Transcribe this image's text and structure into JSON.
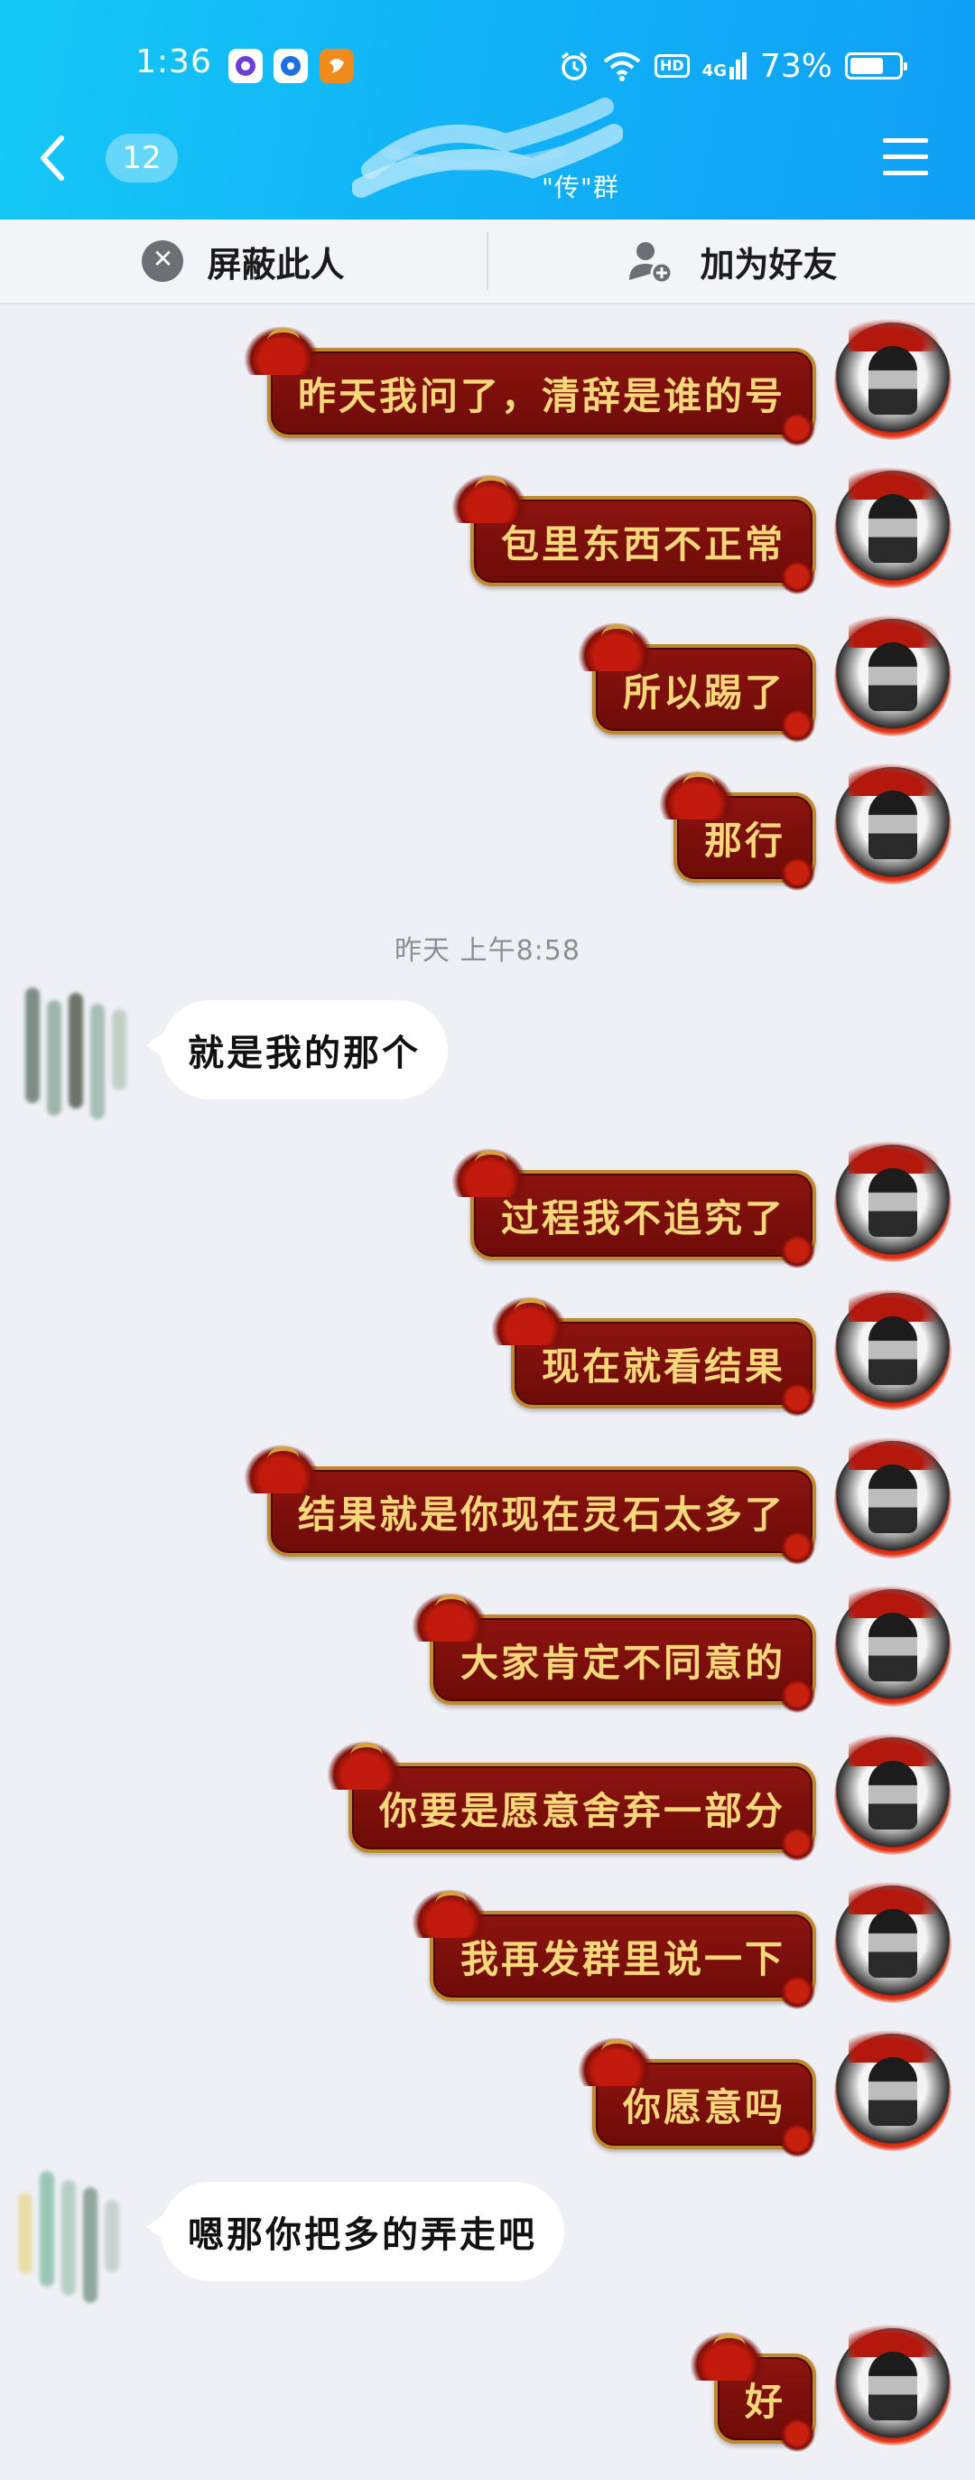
{
  "status_bar": {
    "time": "1:36",
    "hd": "HD",
    "network": "4G",
    "battery": "73%",
    "battery_level": 0.73
  },
  "header": {
    "unread_count": "12",
    "title_visible": "\"传\"群"
  },
  "actions": {
    "block_label": "屏蔽此人",
    "add_friend_label": "加为好友"
  },
  "timestamp": "昨天 上午8:58",
  "messages": [
    {
      "side": "self",
      "text": "昨天我问了，清辞是谁的号"
    },
    {
      "side": "self",
      "text": "包里东西不正常"
    },
    {
      "side": "self",
      "text": "所以踢了"
    },
    {
      "side": "self",
      "text": "那行"
    },
    {
      "side": "other",
      "text": "就是我的那个"
    },
    {
      "side": "self",
      "text": "过程我不追究了"
    },
    {
      "side": "self",
      "text": "现在就看结果"
    },
    {
      "side": "self",
      "text": "结果就是你现在灵石太多了"
    },
    {
      "side": "self",
      "text": "大家肯定不同意的"
    },
    {
      "side": "self",
      "text": "你要是愿意舍弃一部分"
    },
    {
      "side": "self",
      "text": "我再发群里说一下"
    },
    {
      "side": "self",
      "text": "你愿意吗"
    },
    {
      "side": "other",
      "text": "嗯那你把多的弄走吧"
    },
    {
      "side": "self",
      "text": "好"
    }
  ],
  "colors": {
    "header_blue": "#12b4f7",
    "bubble_red": "#7d100c",
    "bubble_gold_text": "#f7d77a",
    "background": "#eef0f5"
  }
}
